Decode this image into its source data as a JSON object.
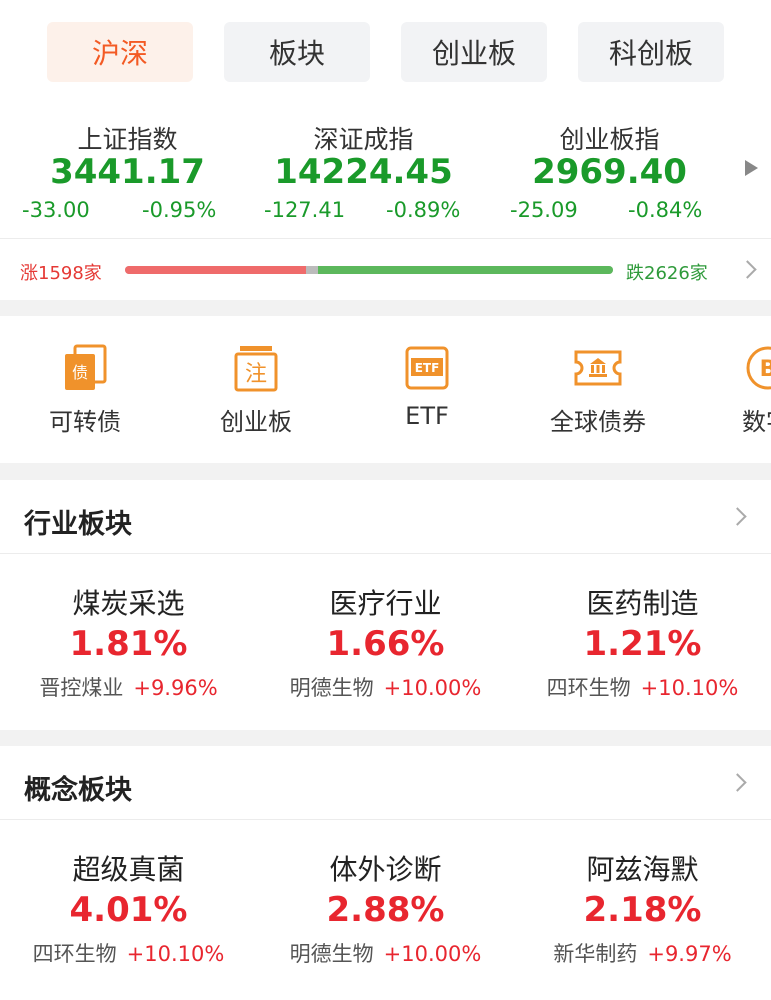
{
  "tabs": [
    {
      "label": "沪深",
      "active": true
    },
    {
      "label": "板块",
      "active": false
    },
    {
      "label": "创业板",
      "active": false
    },
    {
      "label": "科创板",
      "active": false
    }
  ],
  "indices": [
    {
      "name": "上证指数",
      "value": "3441.17",
      "change": "-33.00",
      "pct": "-0.95%"
    },
    {
      "name": "深证成指",
      "value": "14224.45",
      "change": "-127.41",
      "pct": "-0.89%"
    },
    {
      "name": "创业板指",
      "value": "2969.40",
      "change": "-25.09",
      "pct": "-0.84%"
    }
  ],
  "breadth": {
    "rise_label": "涨1598家",
    "fall_label": "跌2626家",
    "rise_fraction": 0.37,
    "fall_fraction": 0.605
  },
  "shortcuts": [
    {
      "label": "可转债",
      "icon": "bond-icon"
    },
    {
      "label": "创业板",
      "icon": "note-icon"
    },
    {
      "label": "ETF",
      "icon": "etf-icon"
    },
    {
      "label": "全球债券",
      "icon": "bank-ticket-icon"
    },
    {
      "label": "数字",
      "icon": "digital-coin-icon"
    }
  ],
  "industry": {
    "title": "行业板块",
    "items": [
      {
        "name": "煤炭采选",
        "pct": "1.81%",
        "leader": "晋控煤业",
        "leader_pct": "+9.96%"
      },
      {
        "name": "医疗行业",
        "pct": "1.66%",
        "leader": "明德生物",
        "leader_pct": "+10.00%"
      },
      {
        "name": "医药制造",
        "pct": "1.21%",
        "leader": "四环生物",
        "leader_pct": "+10.10%"
      }
    ]
  },
  "concept": {
    "title": "概念板块",
    "items": [
      {
        "name": "超级真菌",
        "pct": "4.01%",
        "leader": "四环生物",
        "leader_pct": "+10.10%"
      },
      {
        "name": "体外诊断",
        "pct": "2.88%",
        "leader": "明德生物",
        "leader_pct": "+10.00%"
      },
      {
        "name": "阿兹海默",
        "pct": "2.18%",
        "leader": "新华制药",
        "leader_pct": "+9.97%"
      }
    ]
  },
  "colors": {
    "accent": "#f35a24",
    "up": "#e8262f",
    "down": "#1a9a2a",
    "icon": "#f0922b"
  }
}
